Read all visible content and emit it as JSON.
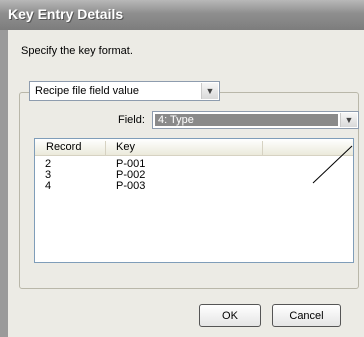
{
  "dialog": {
    "title": "Key Entry Details",
    "instruction": "Specify the key format."
  },
  "format_combo": {
    "value": "Recipe file field value"
  },
  "field": {
    "label": "Field:",
    "value": "4: Type"
  },
  "list": {
    "columns": [
      "Record",
      "Key"
    ],
    "rows": [
      {
        "record": "2",
        "key": "P-001"
      },
      {
        "record": "3",
        "key": "P-002"
      },
      {
        "record": "4",
        "key": "P-003"
      }
    ]
  },
  "buttons": {
    "ok": "OK",
    "cancel": "Cancel"
  },
  "icons": {
    "dropdown": "chevron-down-icon"
  }
}
